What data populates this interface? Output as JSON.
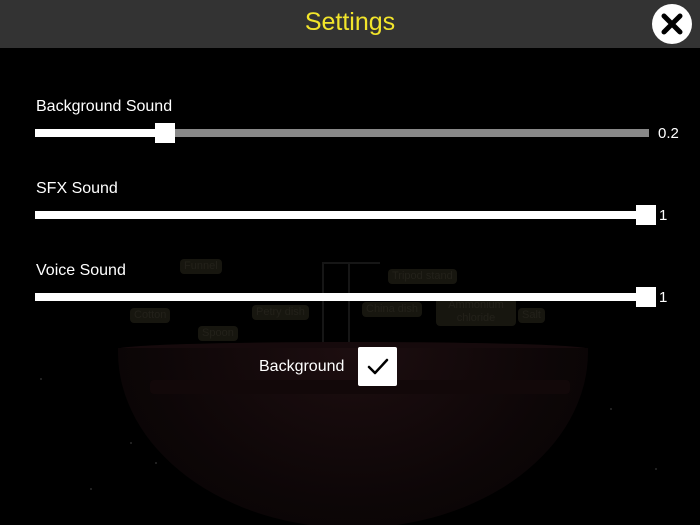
{
  "header": {
    "title": "Settings",
    "close_icon": "close-icon"
  },
  "sliders": [
    {
      "label": "Background Sound",
      "value": 0.2,
      "display": "0.2"
    },
    {
      "label": "SFX Sound",
      "value": 1,
      "display": "1"
    },
    {
      "label": "Voice Sound",
      "value": 1,
      "display": "1"
    }
  ],
  "toggle": {
    "label": "Background",
    "checked": true,
    "icon": "checkmark-icon"
  },
  "scene_labels": {
    "funnel": "Funnel",
    "cotton": "Cotton",
    "spoon": "Spoon",
    "petri_dish": "Petry dish",
    "tripod_stand": "Tripod stand",
    "china_dish": "China dish",
    "ammonium_chloride": "Ammonium chloride",
    "salt": "Salt"
  },
  "colors": {
    "header_bg": "#333333",
    "title": "#f2e52b",
    "track_empty": "#888888",
    "track_fill": "#ffffff"
  }
}
